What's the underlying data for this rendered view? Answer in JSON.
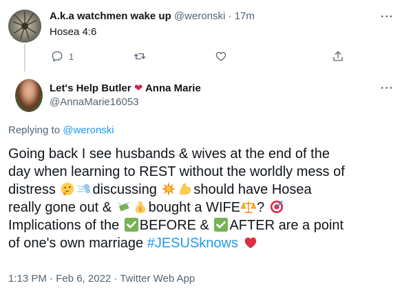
{
  "parent_tweet": {
    "display_name": "A.k.a watchmen wake up",
    "handle": "@weronski",
    "time": "17m",
    "separator": "·",
    "text": "Hosea 4:6",
    "reply_count": "1"
  },
  "main_tweet": {
    "display_name": "Let's Help Butler",
    "heart": "❤",
    "display_name_2": "Anna Marie",
    "handle": "@AnnaMarie16053",
    "replying_prefix": "Replying to",
    "replying_handle": "@weronski",
    "text": {
      "l1": "Going back I see husbands & wives at the end of the",
      "l2": "day when learning to REST without the worldly mess of",
      "l3a": "distress",
      "l3b": "discussing",
      "l3c": "should have Hosea",
      "l4a": "really gone out &",
      "l4b": "bought a WIFE",
      "l4c": "?",
      "l5a": "Implications of the",
      "l5b": "BEFORE &",
      "l5c": "AFTER are a point",
      "l6a": "of one's own marriage",
      "hashtag": "#JESUSknows"
    },
    "timestamp": "1:13 PM · Feb 6, 2022 · Twitter Web App"
  },
  "menu": {
    "more": "···"
  },
  "icons": [
    "more-icon",
    "reply-icon",
    "retweet-icon",
    "like-icon",
    "share-icon",
    "heart-icon",
    "thinking-face-icon",
    "dash-icon",
    "collision-icon",
    "flexed-biceps-icon",
    "money-wings-icon",
    "money-bag-icon",
    "scales-icon",
    "direct-hit-icon",
    "check-mark-icon",
    "sparkling-heart-icon"
  ],
  "colors": {
    "accent": "#1d9bf0",
    "text": "#0f1419",
    "muted": "#536471",
    "heart": "#d6204a",
    "check": "#77b255"
  }
}
